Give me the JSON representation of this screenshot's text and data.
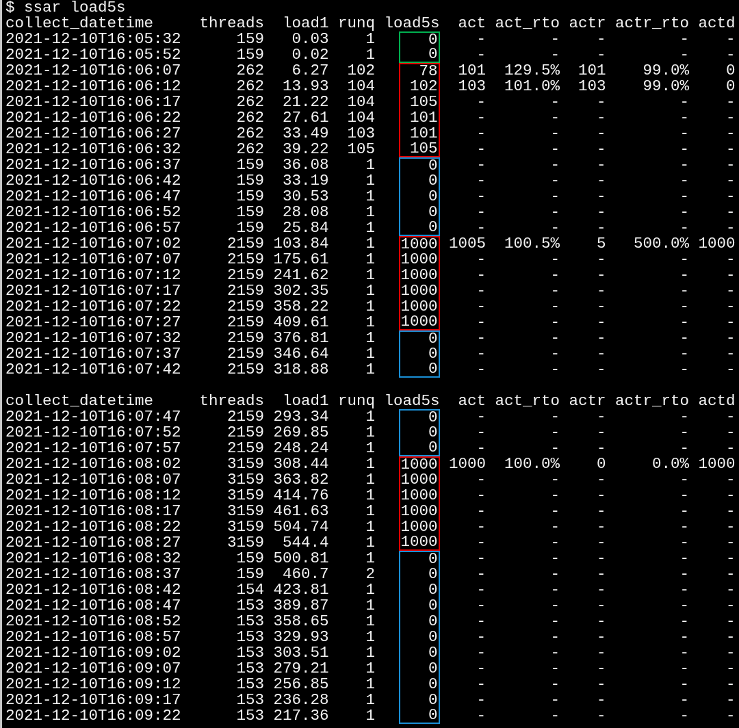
{
  "command": "$ ssar load5s",
  "tables": [
    {
      "columns": [
        "collect_datetime",
        "threads",
        "load1",
        "runq",
        "load5s",
        "act",
        "act_rto",
        "actr",
        "actr_rto",
        "actd"
      ],
      "rows": [
        {
          "cells": [
            "2021-12-10T16:05:32",
            "159",
            "0.03",
            "1",
            "0",
            "-",
            "-",
            "-",
            "-",
            "-"
          ],
          "color": "#00b050"
        },
        {
          "cells": [
            "2021-12-10T16:05:52",
            "159",
            "0.02",
            "1",
            "0",
            "-",
            "-",
            "-",
            "-",
            "-"
          ],
          "color": "#00b050"
        },
        {
          "cells": [
            "2021-12-10T16:06:07",
            "262",
            "6.27",
            "102",
            "78",
            "101",
            "129.5%",
            "101",
            "99.0%",
            "0"
          ],
          "color": "#e00000"
        },
        {
          "cells": [
            "2021-12-10T16:06:12",
            "262",
            "13.93",
            "104",
            "102",
            "103",
            "101.0%",
            "103",
            "99.0%",
            "0"
          ],
          "color": "#e00000"
        },
        {
          "cells": [
            "2021-12-10T16:06:17",
            "262",
            "21.22",
            "104",
            "105",
            "-",
            "-",
            "-",
            "-",
            "-"
          ],
          "color": "#e00000"
        },
        {
          "cells": [
            "2021-12-10T16:06:22",
            "262",
            "27.61",
            "104",
            "101",
            "-",
            "-",
            "-",
            "-",
            "-"
          ],
          "color": "#e00000"
        },
        {
          "cells": [
            "2021-12-10T16:06:27",
            "262",
            "33.49",
            "103",
            "101",
            "-",
            "-",
            "-",
            "-",
            "-"
          ],
          "color": "#e00000"
        },
        {
          "cells": [
            "2021-12-10T16:06:32",
            "262",
            "39.22",
            "105",
            "105",
            "-",
            "-",
            "-",
            "-",
            "-"
          ],
          "color": "#e00000"
        },
        {
          "cells": [
            "2021-12-10T16:06:37",
            "159",
            "36.08",
            "1",
            "0",
            "-",
            "-",
            "-",
            "-",
            "-"
          ],
          "color": "#1a8fd6"
        },
        {
          "cells": [
            "2021-12-10T16:06:42",
            "159",
            "33.19",
            "1",
            "0",
            "-",
            "-",
            "-",
            "-",
            "-"
          ],
          "color": "#1a8fd6"
        },
        {
          "cells": [
            "2021-12-10T16:06:47",
            "159",
            "30.53",
            "1",
            "0",
            "-",
            "-",
            "-",
            "-",
            "-"
          ],
          "color": "#1a8fd6"
        },
        {
          "cells": [
            "2021-12-10T16:06:52",
            "159",
            "28.08",
            "1",
            "0",
            "-",
            "-",
            "-",
            "-",
            "-"
          ],
          "color": "#1a8fd6"
        },
        {
          "cells": [
            "2021-12-10T16:06:57",
            "159",
            "25.84",
            "1",
            "0",
            "-",
            "-",
            "-",
            "-",
            "-"
          ],
          "color": "#1a8fd6"
        },
        {
          "cells": [
            "2021-12-10T16:07:02",
            "2159",
            "103.84",
            "1",
            "1000",
            "1005",
            "100.5%",
            "5",
            "500.0%",
            "1000"
          ],
          "color": "#e00000"
        },
        {
          "cells": [
            "2021-12-10T16:07:07",
            "2159",
            "175.61",
            "1",
            "1000",
            "-",
            "-",
            "-",
            "-",
            "-"
          ],
          "color": "#e00000"
        },
        {
          "cells": [
            "2021-12-10T16:07:12",
            "2159",
            "241.62",
            "1",
            "1000",
            "-",
            "-",
            "-",
            "-",
            "-"
          ],
          "color": "#e00000"
        },
        {
          "cells": [
            "2021-12-10T16:07:17",
            "2159",
            "302.35",
            "1",
            "1000",
            "-",
            "-",
            "-",
            "-",
            "-"
          ],
          "color": "#e00000"
        },
        {
          "cells": [
            "2021-12-10T16:07:22",
            "2159",
            "358.22",
            "1",
            "1000",
            "-",
            "-",
            "-",
            "-",
            "-"
          ],
          "color": "#e00000"
        },
        {
          "cells": [
            "2021-12-10T16:07:27",
            "2159",
            "409.61",
            "1",
            "1000",
            "-",
            "-",
            "-",
            "-",
            "-"
          ],
          "color": "#e00000"
        },
        {
          "cells": [
            "2021-12-10T16:07:32",
            "2159",
            "376.81",
            "1",
            "0",
            "-",
            "-",
            "-",
            "-",
            "-"
          ],
          "color": "#1a8fd6"
        },
        {
          "cells": [
            "2021-12-10T16:07:37",
            "2159",
            "346.64",
            "1",
            "0",
            "-",
            "-",
            "-",
            "-",
            "-"
          ],
          "color": "#1a8fd6"
        },
        {
          "cells": [
            "2021-12-10T16:07:42",
            "2159",
            "318.88",
            "1",
            "0",
            "-",
            "-",
            "-",
            "-",
            "-"
          ],
          "color": "#1a8fd6"
        }
      ]
    },
    {
      "columns": [
        "collect_datetime",
        "threads",
        "load1",
        "runq",
        "load5s",
        "act",
        "act_rto",
        "actr",
        "actr_rto",
        "actd"
      ],
      "rows": [
        {
          "cells": [
            "2021-12-10T16:07:47",
            "2159",
            "293.34",
            "1",
            "0",
            "-",
            "-",
            "-",
            "-",
            "-"
          ],
          "color": "#1a8fd6"
        },
        {
          "cells": [
            "2021-12-10T16:07:52",
            "2159",
            "269.85",
            "1",
            "0",
            "-",
            "-",
            "-",
            "-",
            "-"
          ],
          "color": "#1a8fd6"
        },
        {
          "cells": [
            "2021-12-10T16:07:57",
            "2159",
            "248.24",
            "1",
            "0",
            "-",
            "-",
            "-",
            "-",
            "-"
          ],
          "color": "#1a8fd6"
        },
        {
          "cells": [
            "2021-12-10T16:08:02",
            "3159",
            "308.44",
            "1",
            "1000",
            "1000",
            "100.0%",
            "0",
            "0.0%",
            "1000"
          ],
          "color": "#e00000"
        },
        {
          "cells": [
            "2021-12-10T16:08:07",
            "3159",
            "363.82",
            "1",
            "1000",
            "-",
            "-",
            "-",
            "-",
            "-"
          ],
          "color": "#e00000"
        },
        {
          "cells": [
            "2021-12-10T16:08:12",
            "3159",
            "414.76",
            "1",
            "1000",
            "-",
            "-",
            "-",
            "-",
            "-"
          ],
          "color": "#e00000"
        },
        {
          "cells": [
            "2021-12-10T16:08:17",
            "3159",
            "461.63",
            "1",
            "1000",
            "-",
            "-",
            "-",
            "-",
            "-"
          ],
          "color": "#e00000"
        },
        {
          "cells": [
            "2021-12-10T16:08:22",
            "3159",
            "504.74",
            "1",
            "1000",
            "-",
            "-",
            "-",
            "-",
            "-"
          ],
          "color": "#e00000"
        },
        {
          "cells": [
            "2021-12-10T16:08:27",
            "3159",
            "544.4",
            "1",
            "1000",
            "-",
            "-",
            "-",
            "-",
            "-"
          ],
          "color": "#e00000"
        },
        {
          "cells": [
            "2021-12-10T16:08:32",
            "159",
            "500.81",
            "1",
            "0",
            "-",
            "-",
            "-",
            "-",
            "-"
          ],
          "color": "#1a8fd6"
        },
        {
          "cells": [
            "2021-12-10T16:08:37",
            "159",
            "460.7",
            "2",
            "0",
            "-",
            "-",
            "-",
            "-",
            "-"
          ],
          "color": "#1a8fd6"
        },
        {
          "cells": [
            "2021-12-10T16:08:42",
            "154",
            "423.81",
            "1",
            "0",
            "-",
            "-",
            "-",
            "-",
            "-"
          ],
          "color": "#1a8fd6"
        },
        {
          "cells": [
            "2021-12-10T16:08:47",
            "153",
            "389.87",
            "1",
            "0",
            "-",
            "-",
            "-",
            "-",
            "-"
          ],
          "color": "#1a8fd6"
        },
        {
          "cells": [
            "2021-12-10T16:08:52",
            "153",
            "358.65",
            "1",
            "0",
            "-",
            "-",
            "-",
            "-",
            "-"
          ],
          "color": "#1a8fd6"
        },
        {
          "cells": [
            "2021-12-10T16:08:57",
            "153",
            "329.93",
            "1",
            "0",
            "-",
            "-",
            "-",
            "-",
            "-"
          ],
          "color": "#1a8fd6"
        },
        {
          "cells": [
            "2021-12-10T16:09:02",
            "153",
            "303.51",
            "1",
            "0",
            "-",
            "-",
            "-",
            "-",
            "-"
          ],
          "color": "#1a8fd6"
        },
        {
          "cells": [
            "2021-12-10T16:09:07",
            "153",
            "279.21",
            "1",
            "0",
            "-",
            "-",
            "-",
            "-",
            "-"
          ],
          "color": "#1a8fd6"
        },
        {
          "cells": [
            "2021-12-10T16:09:12",
            "153",
            "256.85",
            "1",
            "0",
            "-",
            "-",
            "-",
            "-",
            "-"
          ],
          "color": "#1a8fd6"
        },
        {
          "cells": [
            "2021-12-10T16:09:17",
            "153",
            "236.28",
            "1",
            "0",
            "-",
            "-",
            "-",
            "-",
            "-"
          ],
          "color": "#1a8fd6"
        },
        {
          "cells": [
            "2021-12-10T16:09:22",
            "153",
            "217.36",
            "1",
            "0",
            "-",
            "-",
            "-",
            "-",
            "-"
          ],
          "color": "#1a8fd6"
        }
      ]
    }
  ]
}
